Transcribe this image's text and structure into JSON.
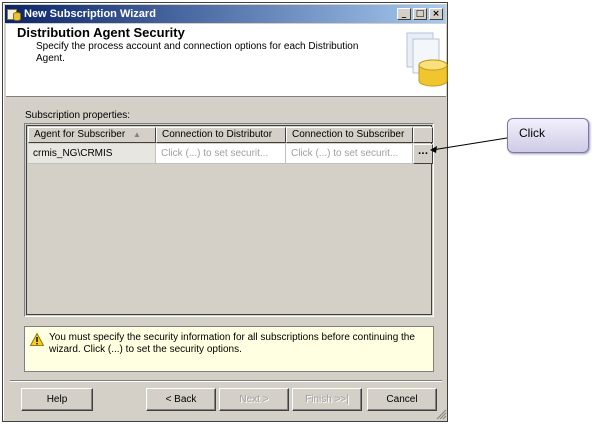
{
  "window": {
    "title": "New Subscription Wizard",
    "minimize": "_",
    "maximize": "□",
    "close": "×"
  },
  "header": {
    "title": "Distribution Agent Security",
    "subtitle": "Specify the process account and connection options for each Distribution Agent."
  },
  "subscription_label": "Subscription properties:",
  "grid": {
    "columns": [
      "Agent for Subscriber",
      "Connection to Distributor",
      "Connection to Subscriber"
    ],
    "sort_indicator": "▲",
    "rows": [
      {
        "agent": "crmis_NG\\CRMIS",
        "distributor": "Click (...) to set securit...",
        "subscriber": "Click (...) to set securit...",
        "ellipsis": "..."
      }
    ]
  },
  "info": {
    "message": "You must specify the security information for all subscriptions before continuing the wizard. Click (...) to set the security options."
  },
  "buttons": {
    "help": "Help",
    "back": "< Back",
    "next": "Next >",
    "finish": "Finish >>|",
    "cancel": "Cancel"
  },
  "callout": {
    "text": "Click"
  },
  "colors": {
    "titlebar_start": "#0a246a",
    "titlebar_end": "#a6caf0",
    "dialog_bg": "#d4d0c8",
    "info_bg": "#ffffe1",
    "callout_border": "#7b78a8"
  }
}
